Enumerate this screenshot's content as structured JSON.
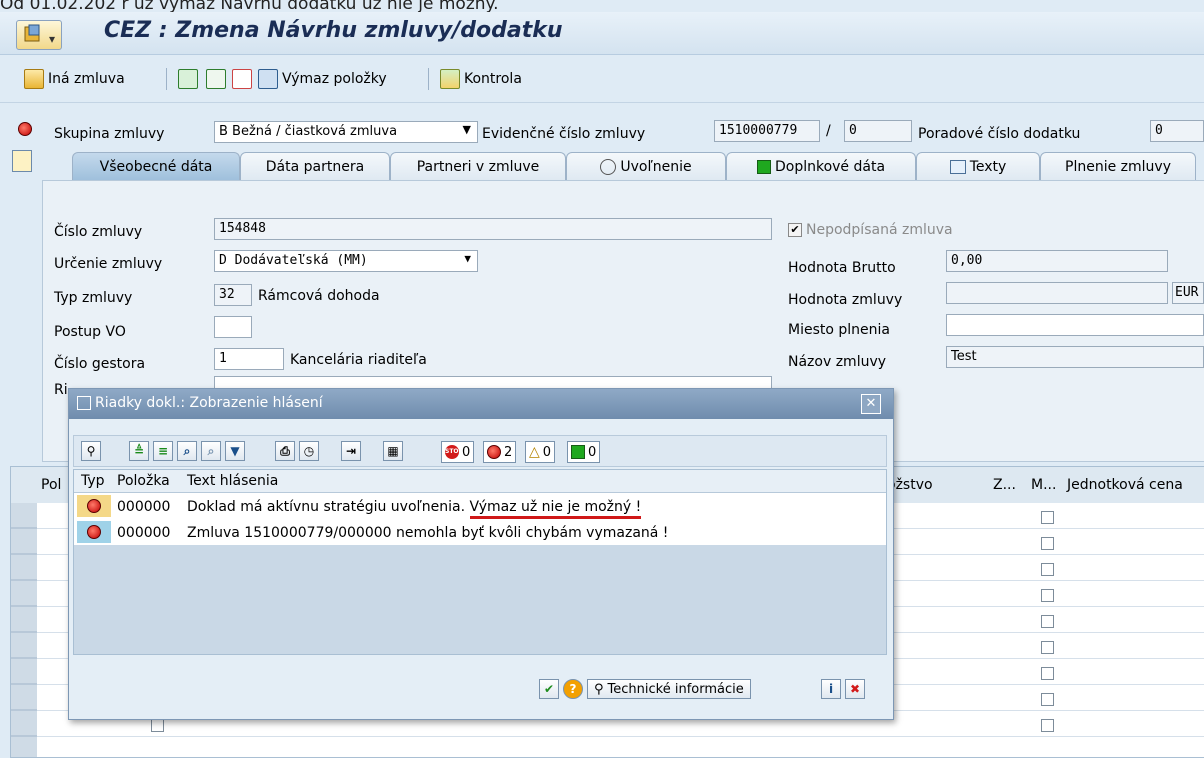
{
  "caption": "Od 01.02.202 r už výmaz Návrhu dodatku už nie je možný.",
  "window": {
    "title": "CEZ : Zmena Návrhu zmluvy/dodatku"
  },
  "toolbar": {
    "other_contract": "Iná zmluva",
    "delete_items": "Výmaz položky",
    "check": "Kontrola"
  },
  "header": {
    "group_label": "Skupina zmluvy",
    "group_value": "B Bežná / čiastková zmluva",
    "evidence_label": "Evidenčné číslo zmluvy",
    "evidence_value": "1510000779",
    "evidence_sep": "/",
    "evidence_suffix": "0",
    "amendment_label": "Poradové číslo dodatku",
    "amendment_value": "0"
  },
  "tabs": [
    {
      "label": "Všeobecné dáta"
    },
    {
      "label": "Dáta partnera"
    },
    {
      "label": "Partneri v zmluve"
    },
    {
      "label": "Uvoľnenie"
    },
    {
      "label": "Doplnkové dáta"
    },
    {
      "label": "Texty"
    },
    {
      "label": "Plnenie zmluvy"
    }
  ],
  "form": {
    "contract_no_label": "Číslo zmluvy",
    "contract_no": "154848",
    "purpose_label": "Určenie zmluvy",
    "purpose_value": "D Dodávateľská (MM)",
    "type_label": "Typ zmluvy",
    "type_code": "32",
    "type_text": "Rámcová dohoda",
    "procedure_label": "Postup VO",
    "sponsor_label": "Číslo gestora",
    "sponsor_code": "1",
    "sponsor_text": "Kancelária riaditeľa",
    "director_label": "Ri",
    "unsigned_label": "Nepodpísaná zmluva",
    "gross_label": "Hodnota Brutto",
    "gross_value": "0,00",
    "value_label": "Hodnota zmluvy",
    "currency": "EUR",
    "place_label": "Miesto plnenia",
    "name_label": "Názov zmluvy",
    "name_value": "Test"
  },
  "grid": {
    "headers": [
      "Pol",
      "ožstvo",
      "Z...",
      "M...",
      "Jednotková cena"
    ]
  },
  "dialog": {
    "title": "Riadky dokl.: Zobrazenie hlásení",
    "counts": {
      "stop": "0",
      "error": "2",
      "warning": "0",
      "ok": "0"
    },
    "col_type": "Typ",
    "col_item": "Položka",
    "col_text": "Text hlásenia",
    "rows": [
      {
        "item": "000000",
        "text_main": "Doklad má aktívnu stratégiu uvoľnenia.",
        "text_underlined": "Výmaz už nie je možný !"
      },
      {
        "item": "000000",
        "text_main": "Zmluva 1510000779/000000 nemohla byť kvôli chybám vymazaná !"
      }
    ],
    "tech_info": "Technické informácie"
  },
  "colors": {
    "underline": "#d01818",
    "tab_active": "#a9c6df",
    "title_text": "#1a2d55"
  }
}
